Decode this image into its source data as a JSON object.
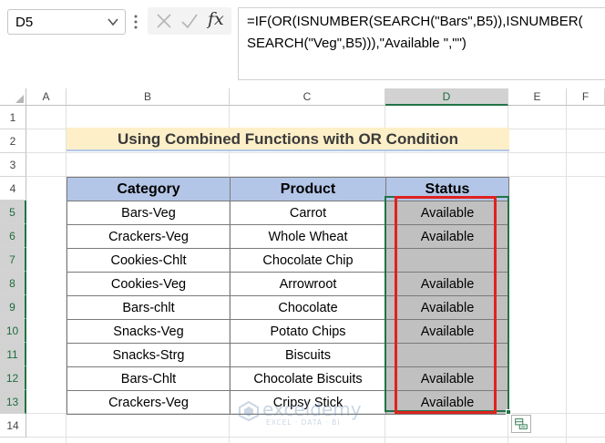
{
  "formula_bar": {
    "name_box": "D5",
    "fx_label": "fx",
    "formula_line1": "=IF(OR(ISNUMBER(SEARCH(\"Bars\",B5)),ISNUMBER(",
    "formula_line2": "SEARCH(\"Veg\",B5))),\"Available \",\"\")"
  },
  "columns": [
    "A",
    "B",
    "C",
    "D",
    "E",
    "F"
  ],
  "rows": [
    "1",
    "2",
    "3",
    "4",
    "5",
    "6",
    "7",
    "8",
    "9",
    "10",
    "11",
    "12",
    "13",
    "14"
  ],
  "sheet": {
    "title": "Using Combined Functions with OR Condition",
    "headers": [
      "Category",
      "Product",
      "Status"
    ],
    "table": [
      [
        "Bars-Veg",
        "Carrot",
        "Available"
      ],
      [
        "Crackers-Veg",
        "Whole Wheat",
        "Available"
      ],
      [
        "Cookies-Chlt",
        "Chocolate Chip",
        ""
      ],
      [
        "Cookies-Veg",
        "Arrowroot",
        "Available"
      ],
      [
        "Bars-chlt",
        "Chocolate",
        "Available"
      ],
      [
        "Snacks-Veg",
        "Potato Chips",
        "Available"
      ],
      [
        "Snacks-Strg",
        "Biscuits",
        ""
      ],
      [
        "Bars-Chlt",
        "Chocolate Biscuits",
        "Available"
      ],
      [
        "Crackers-Veg",
        "Cripsy Stick",
        "Available"
      ]
    ]
  },
  "watermark": {
    "name": "exceldemy",
    "tagline": "EXCEL · DATA · BI"
  },
  "colors": {
    "title_fill": "#fdefc8",
    "header_fill": "#b4c6e7",
    "status_fill": "#c0c0c0",
    "highlight_box": "#e0221f",
    "selection": "#217346"
  }
}
